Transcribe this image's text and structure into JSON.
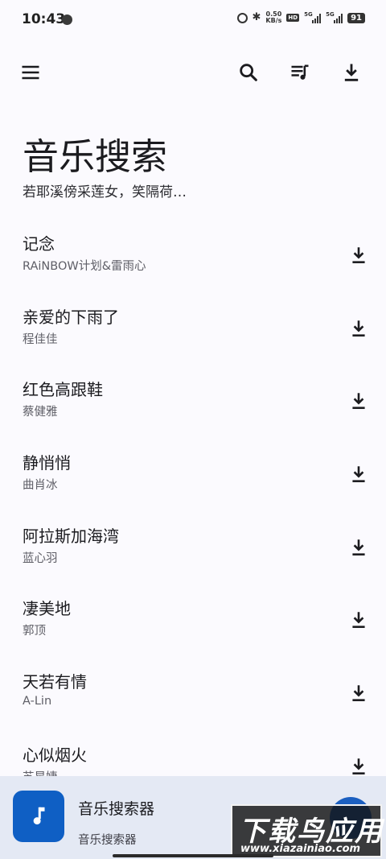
{
  "status_bar": {
    "time": "10:43",
    "net_speed_value": "0.50",
    "net_speed_unit": "KB/s",
    "hd_label": "HD",
    "sim1_label": "5G",
    "sim2_label": "5G",
    "battery": "91"
  },
  "header": {
    "title": "音乐搜索",
    "subtitle": "若耶溪傍采莲女，笑隔荷…"
  },
  "songs": [
    {
      "title": "记念",
      "artist": "RAiNBOW计划&雷雨心"
    },
    {
      "title": "亲爱的下雨了",
      "artist": "程佳佳"
    },
    {
      "title": "红色高跟鞋",
      "artist": "蔡健雅"
    },
    {
      "title": "静悄悄",
      "artist": "曲肖冰"
    },
    {
      "title": "阿拉斯加海湾",
      "artist": "蓝心羽"
    },
    {
      "title": "凄美地",
      "artist": "郭顶"
    },
    {
      "title": "天若有情",
      "artist": "A-Lin"
    },
    {
      "title": "心似烟火",
      "artist": "苏星婕"
    }
  ],
  "player": {
    "title": "音乐搜索器",
    "subtitle": "音乐搜索器"
  },
  "watermark": {
    "main": "下载鸟应用",
    "url": "www.xiazainiao.com"
  },
  "colors": {
    "background": "#fbfafe",
    "accent": "#0f5fc4",
    "player_bg": "#e4e9f4"
  }
}
